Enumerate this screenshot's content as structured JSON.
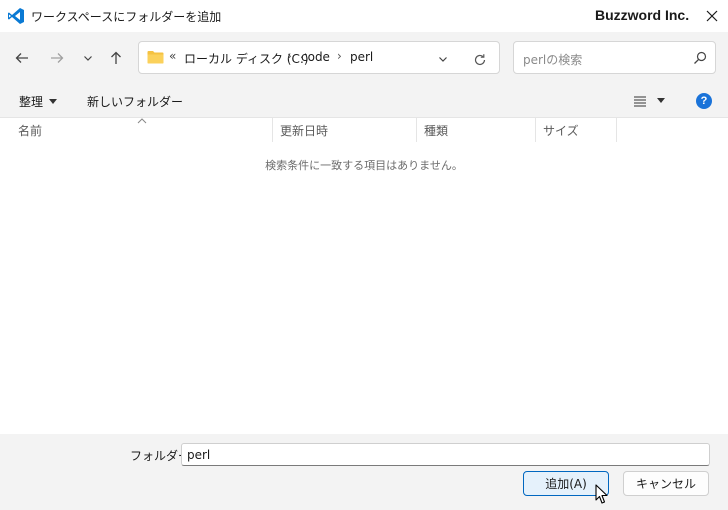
{
  "window": {
    "title": "ワークスペースにフォルダーを追加",
    "brand": "Buzzword Inc."
  },
  "navigation": {
    "breadcrumbs": [
      "ローカル ディスク (C:)",
      "code",
      "perl"
    ],
    "overflow": "«",
    "separator": "›"
  },
  "search": {
    "placeholder": "perlの検索"
  },
  "commandbar": {
    "organize_label": "整理",
    "new_folder_label": "新しいフォルダー"
  },
  "columns": [
    "名前",
    "更新日時",
    "種類",
    "サイズ"
  ],
  "empty_message": "検索条件に一致する項目はありません。",
  "footer": {
    "folder_label": "フォルダー:",
    "folder_value": "perl",
    "add_button": "追加(A)",
    "cancel_button": "キャンセル"
  },
  "colors": {
    "accent": "#0067c0",
    "help": "#1a73d9",
    "vscode_blue": "#0a7ad4",
    "folder_yellow": "#f5c242"
  }
}
